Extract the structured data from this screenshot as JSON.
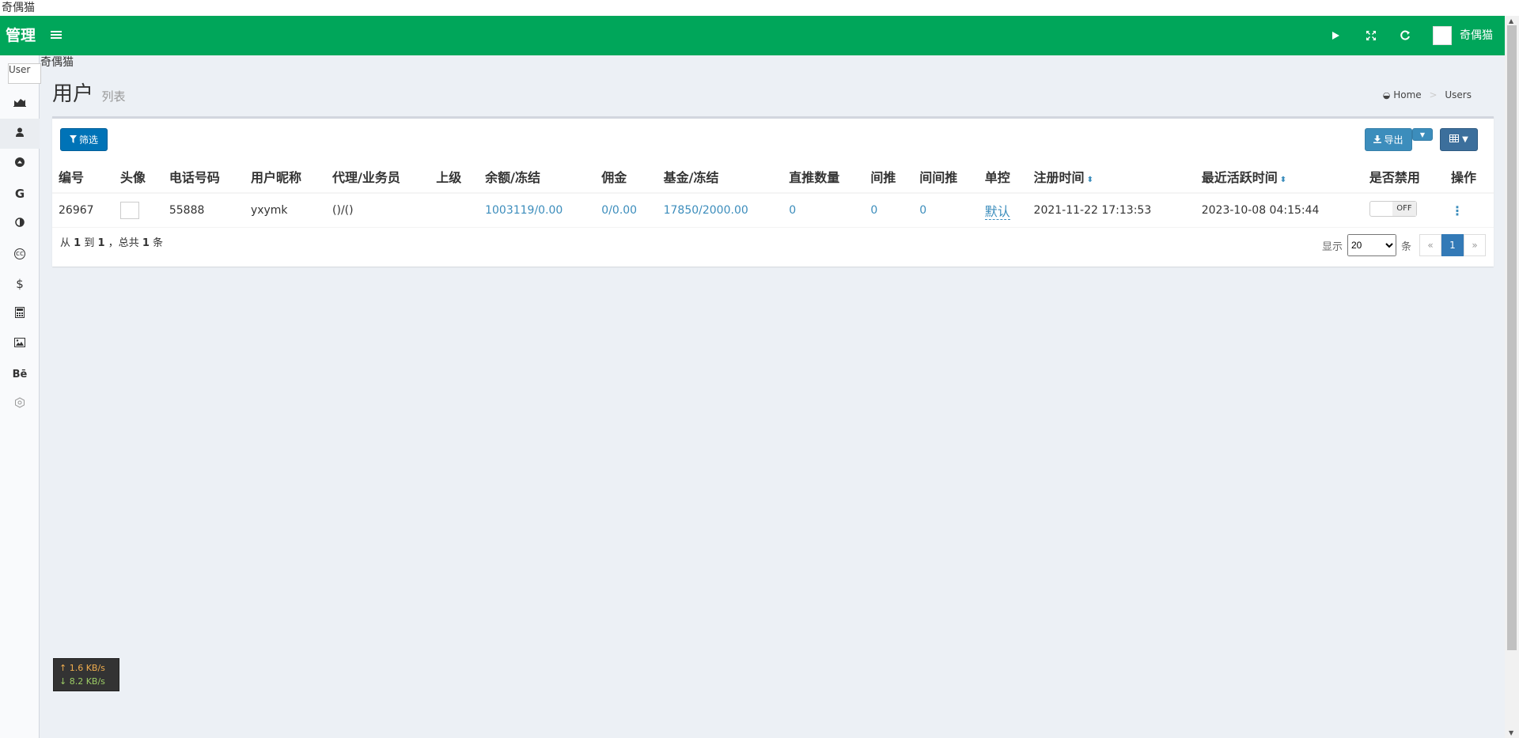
{
  "window": {
    "title": "奇偶猫"
  },
  "topbar": {
    "logo": "管理",
    "user_name": "奇偶猫"
  },
  "sidebar": {
    "user_alt": "User",
    "name": "奇偶猫"
  },
  "header": {
    "title": "用户",
    "subtitle": "列表"
  },
  "breadcrumb": {
    "home": "Home",
    "current": "Users"
  },
  "toolbar": {
    "filter_label": "筛选",
    "export_label": "导出"
  },
  "table": {
    "columns": [
      "编号",
      "头像",
      "电话号码",
      "用户昵称",
      "代理/业务员",
      "上级",
      "余额/冻结",
      "佣金",
      "基金/冻结",
      "直推数量",
      "间推",
      "间间推",
      "单控",
      "注册时间",
      "最近活跃时间",
      "是否禁用",
      "操作"
    ],
    "rows": [
      {
        "id": "26967",
        "phone": "55888",
        "nickname": "yxymk",
        "agent": "()/()",
        "parent": "",
        "balance": "1003119/0.00",
        "commission": "0/0.00",
        "fund": "17850/2000.00",
        "direct": "0",
        "indirect": "0",
        "indirect2": "0",
        "control": "默认",
        "registered": "2021-11-22 17:13:53",
        "last_active": "2023-10-08 04:15:44",
        "disabled": "OFF"
      }
    ]
  },
  "pagination": {
    "info_prefix": "从",
    "from": "1",
    "to_text": "到",
    "to": "1",
    "total_text": "，总共",
    "total": "1",
    "unit": "条",
    "show_label": "显示",
    "per_page": "20",
    "per_page_unit": "条",
    "prev": "«",
    "current": "1",
    "next": "»"
  },
  "netspeed": {
    "up": "↑ 1.6 KB/s",
    "down": "↓ 8.2 KB/s"
  },
  "colors": {
    "header": "#00a65a",
    "primary": "#3c8dbc"
  }
}
